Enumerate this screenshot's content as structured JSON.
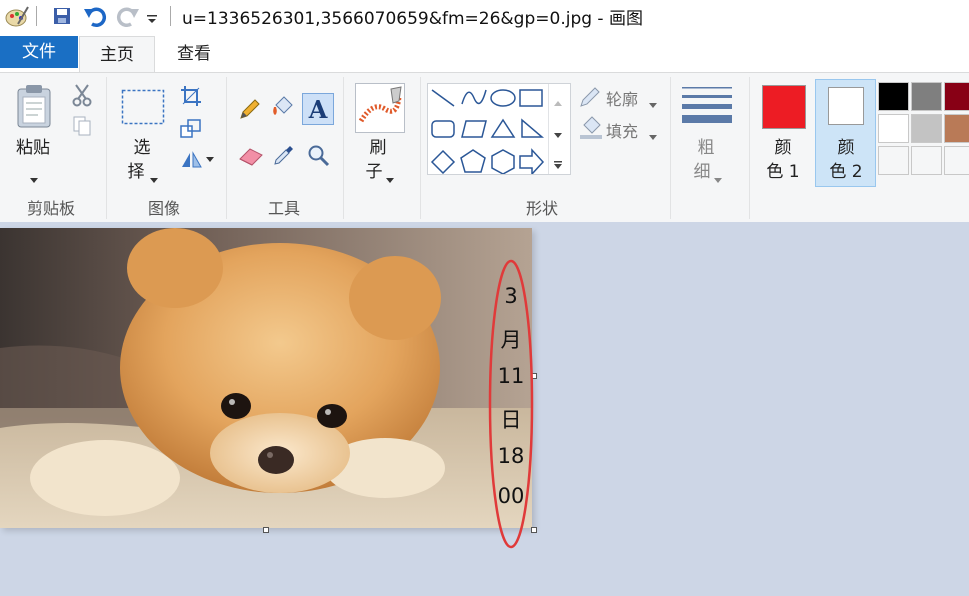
{
  "window": {
    "title": "u=1336526301,3566070659&fm=26&gp=0.jpg - 画图"
  },
  "quick_access": {
    "icons": [
      "paint-app-icon",
      "save-icon",
      "undo-icon",
      "redo-icon",
      "customize-arrow-icon"
    ]
  },
  "tabs": [
    {
      "label": "文件"
    },
    {
      "label": "主页"
    },
    {
      "label": "查看"
    }
  ],
  "ribbon": {
    "clipboard": {
      "group_label": "剪贴板",
      "paste_label": "粘贴"
    },
    "image": {
      "group_label": "图像",
      "select_line1": "选",
      "select_line2": "择"
    },
    "tools": {
      "group_label": "工具"
    },
    "brushes": {
      "label_line1": "刷",
      "label_line2": "子"
    },
    "shapes": {
      "group_label": "形状",
      "outline_label": "轮廓",
      "fill_label": "填充"
    },
    "size": {
      "line1": "粗",
      "line2": "细"
    },
    "color1": {
      "line1": "颜",
      "line2": "色 1",
      "color": "#ed1c24"
    },
    "color2": {
      "line1": "颜",
      "line2": "色 2",
      "color": "#ffffff"
    },
    "palette": [
      "#000000",
      "#7f7f7f",
      "#880015",
      "#ffffff",
      "#c3c3c3",
      "#b97a57",
      "#f5f6f7",
      "#f5f6f7",
      "#f5f6f7"
    ]
  },
  "canvas": {
    "annotation_text": [
      "3",
      "月",
      "11",
      "日",
      "18",
      "00"
    ],
    "annotation_color": "#e03a3a"
  }
}
